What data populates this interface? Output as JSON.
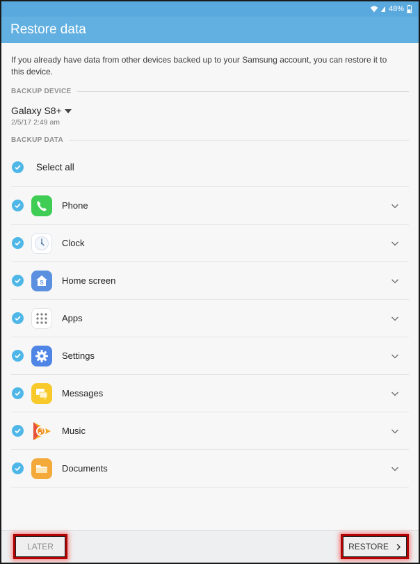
{
  "status_bar": {
    "battery": "48%"
  },
  "app_bar": {
    "title": "Restore data"
  },
  "description": "If you already have data from other devices backed up to your Samsung account, you can restore it to this device.",
  "backup_device": {
    "section_label": "BACKUP DEVICE",
    "name": "Galaxy S8+",
    "date": "2/5/17 2:49 am"
  },
  "backup_data": {
    "section_label": "BACKUP DATA",
    "select_all": "Select all",
    "items": [
      {
        "label": "Phone",
        "icon": "phone-icon"
      },
      {
        "label": "Clock",
        "icon": "clock-icon"
      },
      {
        "label": "Home screen",
        "icon": "home-screen-icon"
      },
      {
        "label": "Apps",
        "icon": "apps-grid-icon"
      },
      {
        "label": "Settings",
        "icon": "settings-gear-icon"
      },
      {
        "label": "Messages",
        "icon": "messages-icon"
      },
      {
        "label": "Music",
        "icon": "music-icon"
      },
      {
        "label": "Documents",
        "icon": "documents-folder-icon"
      }
    ]
  },
  "bottom_bar": {
    "later": "LATER",
    "restore": "RESTORE"
  },
  "colors": {
    "accent": "#4fb7e8",
    "app_bar": "#62b0e1",
    "highlight": "#b00000"
  }
}
